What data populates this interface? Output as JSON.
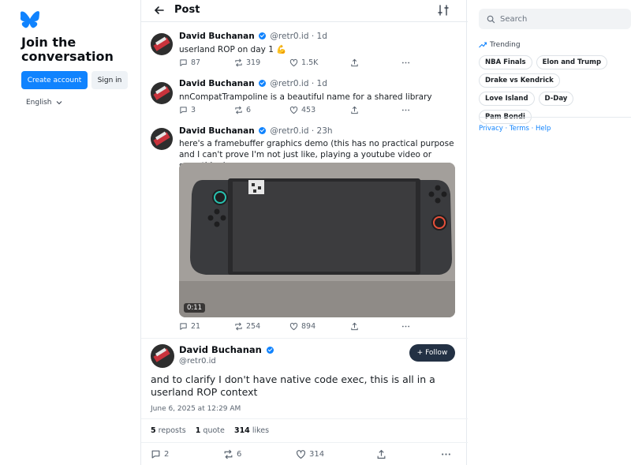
{
  "sidebar": {
    "join_title": "Join the conversation",
    "create_account_label": "Create account",
    "sign_in_label": "Sign in",
    "language": "English"
  },
  "header": {
    "title": "Post"
  },
  "replies": [
    {
      "name": "David Buchanan",
      "handle": "@retr0.id",
      "time": "· 1d",
      "text": "userland ROP on day 1 💪",
      "replies": "87",
      "reposts": "319",
      "likes": "1.5K"
    },
    {
      "name": "David Buchanan",
      "handle": "@retr0.id",
      "time": "· 1d",
      "text": "nnCompatTrampoline is a beautiful name for a shared library",
      "replies": "3",
      "reposts": "6",
      "likes": "453"
    },
    {
      "name": "David Buchanan",
      "handle": "@retr0.id",
      "time": "· 23h",
      "text": "here's a framebuffer graphics demo (this has no practical purpose and I can't prove I'm not just like, playing a youtube video or something)",
      "video_duration": "0:11",
      "replies": "21",
      "reposts": "254",
      "likes": "894"
    }
  ],
  "main_post": {
    "name": "David Buchanan",
    "handle": "@retr0.id",
    "follow_label": "+ Follow",
    "text": "and to clarify I don't have native code exec, this is all in a userland ROP context",
    "date": "June 6, 2025 at 12:29 AM",
    "repost_count": "5",
    "repost_label": "reposts",
    "quote_count": "1",
    "quote_label": "quote",
    "like_count": "314",
    "like_label": "likes",
    "replies": "2",
    "reposts": "6",
    "likes": "314"
  },
  "right": {
    "search_placeholder": "Search",
    "trending_label": "Trending",
    "trending": [
      "NBA Finals",
      "Elon and Trump",
      "Drake vs Kendrick",
      "Love Island",
      "D-Day",
      "Pam Bondi"
    ],
    "links": [
      "Privacy",
      "Terms",
      "Help"
    ]
  },
  "colors": {
    "accent": "#1083fe",
    "follow_bg": "#233144",
    "text": "#1a1f24",
    "muted": "#5b6571"
  },
  "icons": [
    "butterfly-logo-icon",
    "chevron-down-icon",
    "back-arrow-icon",
    "filter-icon",
    "reply-icon",
    "repost-icon",
    "like-icon",
    "share-icon",
    "more-icon",
    "search-icon",
    "trending-icon"
  ]
}
